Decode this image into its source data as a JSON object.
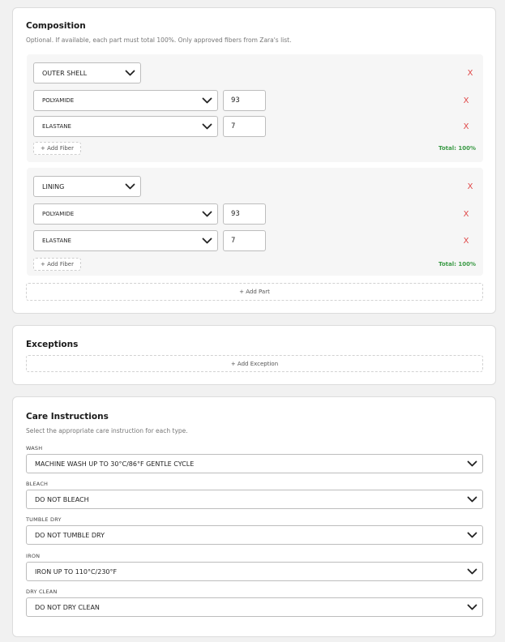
{
  "composition": {
    "title": "Composition",
    "subtitle": "Optional. If available, each part must total 100%. Only approved fibers from Zara's list.",
    "parts": [
      {
        "part": "OUTER SHELL",
        "fibers": [
          {
            "fiber": "POLYAMIDE",
            "percent": "93"
          },
          {
            "fiber": "ELASTANE",
            "percent": "7"
          }
        ],
        "add_fiber_label": "+ Add Fiber",
        "total": "Total: 100%"
      },
      {
        "part": "LINING",
        "fibers": [
          {
            "fiber": "POLYAMIDE",
            "percent": "93"
          },
          {
            "fiber": "ELASTANE",
            "percent": "7"
          }
        ],
        "add_fiber_label": "+ Add Fiber",
        "total": "Total: 100%"
      }
    ],
    "remove_label": "X",
    "add_part_label": "+ Add Part"
  },
  "exceptions": {
    "title": "Exceptions",
    "add_exception_label": "+ Add Exception"
  },
  "care": {
    "title": "Care Instructions",
    "subtitle": "Select the appropriate care instruction for each type.",
    "items": [
      {
        "label": "WASH",
        "value": "MACHINE WASH UP TO 30°C/86°F GENTLE CYCLE"
      },
      {
        "label": "BLEACH",
        "value": "DO NOT BLEACH"
      },
      {
        "label": "TUMBLE DRY",
        "value": "DO NOT TUMBLE DRY"
      },
      {
        "label": "IRON",
        "value": "IRON UP TO 110°C/230°F"
      },
      {
        "label": "DRY CLEAN",
        "value": "DO NOT DRY CLEAN"
      }
    ]
  },
  "colors": {
    "remove": "#e04848",
    "total_ok": "#3a9a45",
    "card_bg": "#ffffff",
    "page_bg": "#f1f1f1"
  },
  "icons": {
    "dropdown": "chevron-down-icon",
    "remove": "close-icon"
  }
}
